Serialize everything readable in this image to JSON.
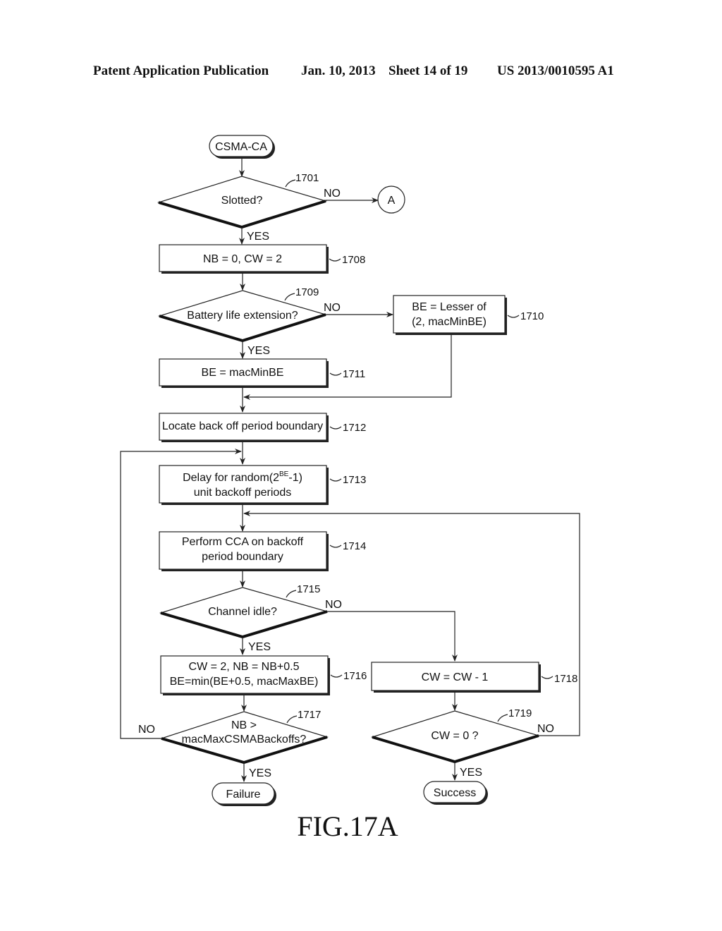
{
  "header": {
    "left": "Patent Application Publication",
    "date": "Jan. 10, 2013",
    "sheet": "Sheet 14 of 19",
    "number": "US 2013/0010595 A1"
  },
  "figure_label": "FIG.17A",
  "nodes": {
    "start": {
      "text": "CSMA-CA"
    },
    "slotted": {
      "text": "Slotted?",
      "ref": "1701"
    },
    "connector_a": {
      "text": "A"
    },
    "init": {
      "text": "NB = 0, CW = 2",
      "ref": "1708"
    },
    "battery": {
      "text": "Battery life extension?",
      "ref": "1709"
    },
    "be_lesser": {
      "line1": "BE = Lesser of",
      "line2": "(2, macMinBE)",
      "ref": "1710"
    },
    "be_min": {
      "text": "BE = macMinBE",
      "ref": "1711"
    },
    "locate": {
      "text": "Locate back off period boundary",
      "ref": "1712"
    },
    "delay": {
      "line1_pre": "Delay for random(2",
      "line1_sup": "BE",
      "line1_post": "-1)",
      "line2": "unit backoff periods",
      "ref": "1713"
    },
    "cca": {
      "line1": "Perform CCA on backoff",
      "line2": "period boundary",
      "ref": "1714"
    },
    "idle": {
      "text": "Channel idle?",
      "ref": "1715"
    },
    "update": {
      "line1": "CW = 2, NB = NB+0.5",
      "line2": "BE=min(BE+0.5, macMaxBE)",
      "ref": "1716"
    },
    "nb_check": {
      "line1": "NB >",
      "line2": "macMaxCSMABackoffs?",
      "ref": "1717"
    },
    "cw_dec": {
      "text": "CW = CW - 1",
      "ref": "1718"
    },
    "cw_check": {
      "text": "CW = 0 ?",
      "ref": "1719"
    },
    "failure": {
      "text": "Failure"
    },
    "success": {
      "text": "Success"
    }
  },
  "edge_labels": {
    "yes": "YES",
    "no": "NO"
  }
}
